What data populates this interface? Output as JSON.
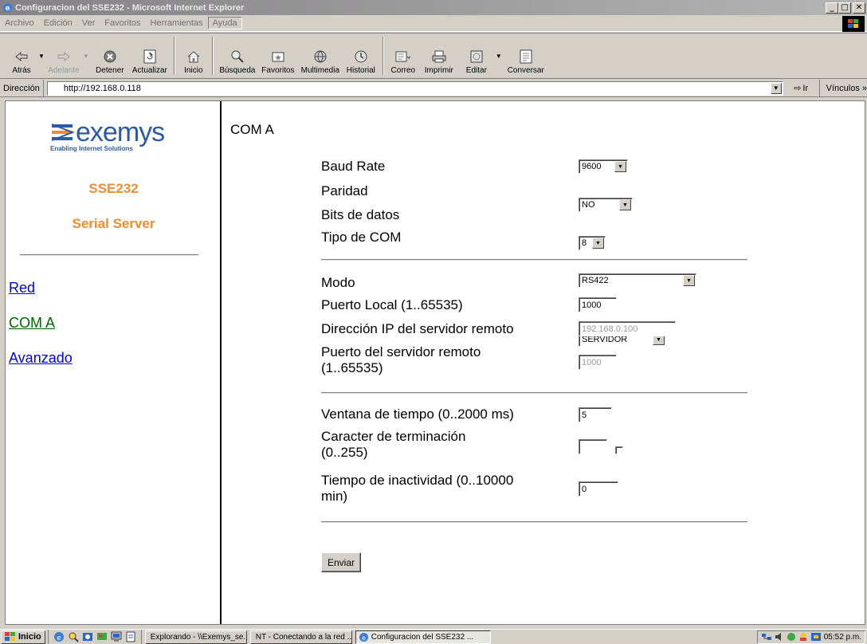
{
  "window": {
    "title": "Configuracion del SSE232 - Microsoft Internet Explorer",
    "controls": {
      "minimize": "_",
      "maximize": "□",
      "close": "✕"
    }
  },
  "menu": [
    "Archivo",
    "Edición",
    "Ver",
    "Favoritos",
    "Herramientas",
    "Ayuda"
  ],
  "toolbar": {
    "back": "Atrás",
    "forward": "Adelante",
    "stop": "Detener",
    "refresh": "Actualizar",
    "home": "Inicio",
    "search": "Búsqueda",
    "favorites": "Favoritos",
    "media": "Multimedia",
    "history": "Historial",
    "mail": "Correo",
    "print": "Imprimir",
    "edit": "Editar",
    "discuss": "Conversar"
  },
  "address": {
    "label": "Dirección",
    "url": "http://192.168.0.118",
    "go": "Ir",
    "links": "Vínculos »"
  },
  "sidebar": {
    "logo_text": "exemys",
    "logo_tagline": "Enabling Internet Solutions",
    "product": "SSE232",
    "subtitle": "Serial Server",
    "nav": [
      {
        "label": "Red"
      },
      {
        "label": "COM A"
      },
      {
        "label": "Avanzado"
      }
    ]
  },
  "form": {
    "page_title": "COM A",
    "baud_rate": {
      "label": "Baud Rate",
      "value": "9600"
    },
    "parity": {
      "label": "Paridad",
      "value": "NO"
    },
    "data_bits": {
      "label": "Bits de datos",
      "value": "8"
    },
    "com_type": {
      "label": "Tipo de COM",
      "value": "RS422"
    },
    "mode": {
      "label": "Modo",
      "value": "SERVIDOR"
    },
    "local_port": {
      "label": "Puerto Local (1..65535)",
      "value": "1000"
    },
    "remote_ip": {
      "label": "Dirección IP del servidor remoto",
      "value": "192.168.0.100"
    },
    "remote_port": {
      "label_1": "Puerto del servidor remoto",
      "label_2": "(1..65535)",
      "value": "1000"
    },
    "time_window": {
      "label": "Ventana de tiempo (0..2000 ms)",
      "value": "5"
    },
    "term_char": {
      "label_1": "Caracter de terminación",
      "label_2": "(0..255)",
      "value": "",
      "checked": false
    },
    "idle_time": {
      "label_1": "Tiempo de inactividad (0..10000",
      "label_2": "min)",
      "value": "0"
    },
    "submit": "Enviar"
  },
  "taskbar": {
    "start": "Inicio",
    "tasks": [
      {
        "label": "Explorando - \\\\Exemys_se..."
      },
      {
        "label": "NT - Conectando a la red ..."
      },
      {
        "label": "Configuracion del SSE232 ..."
      }
    ],
    "clock": "05:52 p.m."
  },
  "colors": {
    "brand_orange": "#f28c30",
    "link_blue": "#0000ee",
    "visited_green": "#006600",
    "logo_blue": "#2b5aa8"
  }
}
